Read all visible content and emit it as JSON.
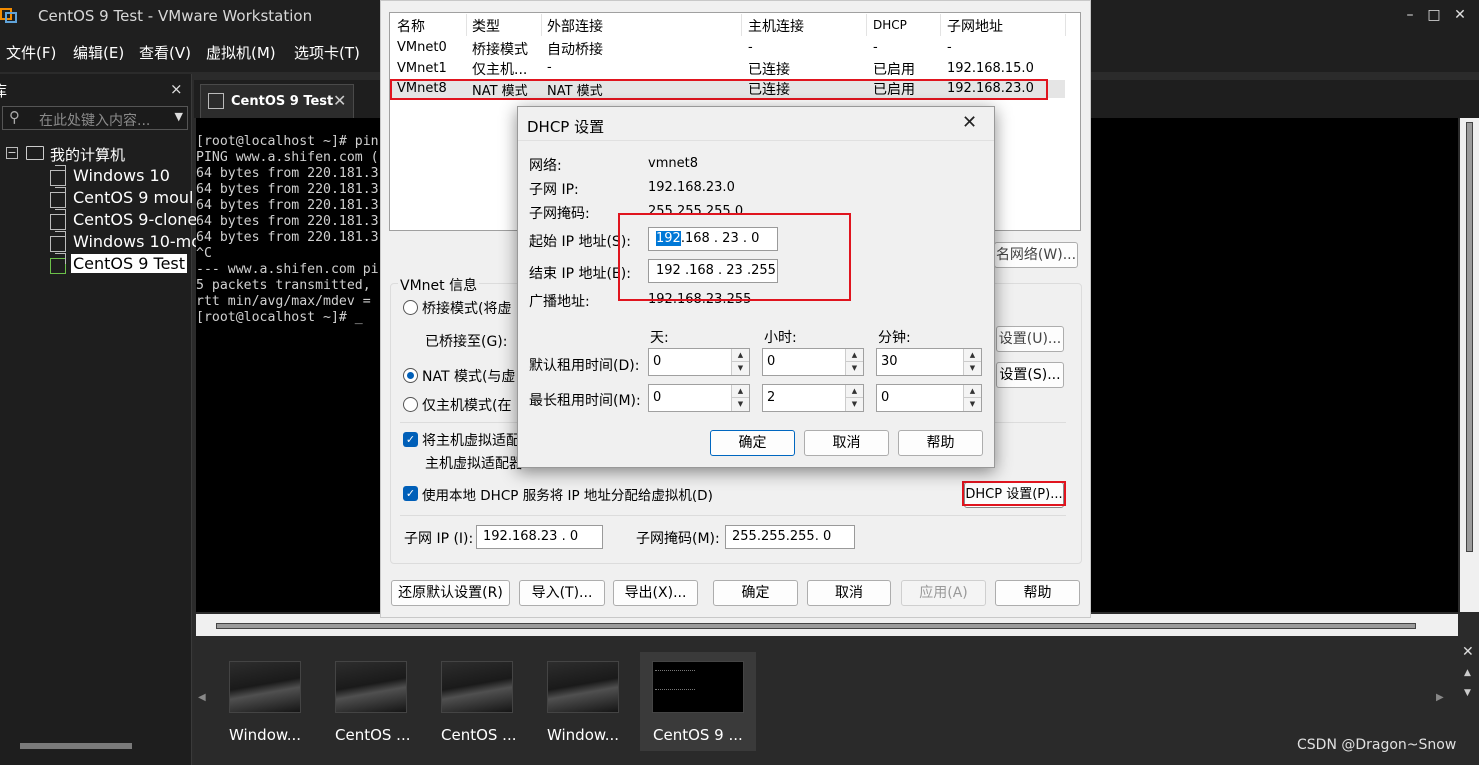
{
  "app": {
    "title": "CentOS 9 Test - VMware Workstation",
    "window_controls": [
      "–",
      "□",
      "✕"
    ]
  },
  "menubar": {
    "items": [
      "文件(F)",
      "编辑(E)",
      "查看(V)",
      "虚拟机(M)",
      "选项卡(T)"
    ]
  },
  "library": {
    "header": "库",
    "close": "×",
    "search_placeholder": "在此处键入内容...",
    "root": "我的计算机",
    "vms": [
      "Windows 10",
      "CentOS 9 moul",
      "CentOS 9-clone",
      "Windows 10-mo",
      "CentOS 9 Test"
    ],
    "selected_vm": "CentOS 9 Test"
  },
  "tab": {
    "label": "CentOS 9 Test",
    "close": "✕"
  },
  "console": {
    "lines": [
      "[root@localhost ~]# pin",
      "PING www.a.shifen.com (",
      "64 bytes from 220.181.3",
      "64 bytes from 220.181.3",
      "64 bytes from 220.181.3",
      "64 bytes from 220.181.3",
      "64 bytes from 220.181.3",
      "^C",
      "--- www.a.shifen.com pi",
      "5 packets transmitted, ",
      "rtt min/avg/max/mdev = ",
      "[root@localhost ~]# _"
    ]
  },
  "thumbnails": [
    "Window...",
    "CentOS ...",
    "CentOS ...",
    "Window...",
    "CentOS 9 ..."
  ],
  "watermark": "CSDN @Dragon~Snow",
  "vne": {
    "columns": [
      "名称",
      "类型",
      "外部连接",
      "主机连接",
      "DHCP",
      "子网地址"
    ],
    "rows": [
      [
        "VMnet0",
        "桥接模式",
        "自动桥接",
        "-",
        "-",
        "-"
      ],
      [
        "VMnet1",
        "仅主机...",
        "-",
        "已连接",
        "已启用",
        "192.168.15.0"
      ],
      [
        "VMnet8",
        "NAT 模式",
        "NAT 模式",
        "已连接",
        "已启用",
        "192.168.23.0"
      ]
    ],
    "rename_button": "名网络(W)...",
    "vmnet_info_label": "VMnet 信息",
    "bridge_radio": "桥接模式(将虚",
    "bridged_to_label": "已桥接至(G):",
    "auto_settings_button": "设置(U)...",
    "nat_radio": "NAT 模式(与虚",
    "nat_settings_button": "设置(S)...",
    "hostonly_radio": "仅主机模式(在",
    "connect_adapter_check": "将主机虚拟适配",
    "adapter_name_label": "主机虚拟适配器",
    "dhcp_check": "使用本地 DHCP 服务将 IP 地址分配给虚拟机(D)",
    "dhcp_settings_button": "DHCP 设置(P)...",
    "subnet_ip_label": "子网 IP (I):",
    "subnet_ip_value": "192.168.23 . 0",
    "subnet_mask_label": "子网掩码(M):",
    "subnet_mask_value": "255.255.255. 0",
    "bottom_buttons": {
      "restore": "还原默认设置(R)",
      "import": "导入(T)...",
      "export": "导出(X)...",
      "ok": "确定",
      "cancel": "取消",
      "apply": "应用(A)",
      "help": "帮助"
    }
  },
  "dhcp": {
    "title": "DHCP 设置",
    "close": "✕",
    "network_label": "网络:",
    "network_value": "vmnet8",
    "subnet_ip_label": "子网 IP:",
    "subnet_ip_value": "192.168.23.0",
    "subnet_mask_label": "子网掩码:",
    "subnet_mask_value": "255.255.255.0",
    "start_ip_label": "起始 IP 地址(S):",
    "start_ip_selected": "192",
    "start_ip_rest": ".168 . 23 . 0",
    "end_ip_label": "结束 IP 地址(E):",
    "end_ip_value": "192 .168 . 23 .255",
    "broadcast_label": "广播地址:",
    "broadcast_value": "192.168.23.255",
    "col_days": "天:",
    "col_hours": "小时:",
    "col_minutes": "分钟:",
    "default_lease_label": "默认租用时间(D):",
    "default_lease": [
      "0",
      "0",
      "30"
    ],
    "max_lease_label": "最长租用时间(M):",
    "max_lease": [
      "0",
      "2",
      "0"
    ],
    "ok": "确定",
    "cancel": "取消",
    "help": "帮助"
  }
}
